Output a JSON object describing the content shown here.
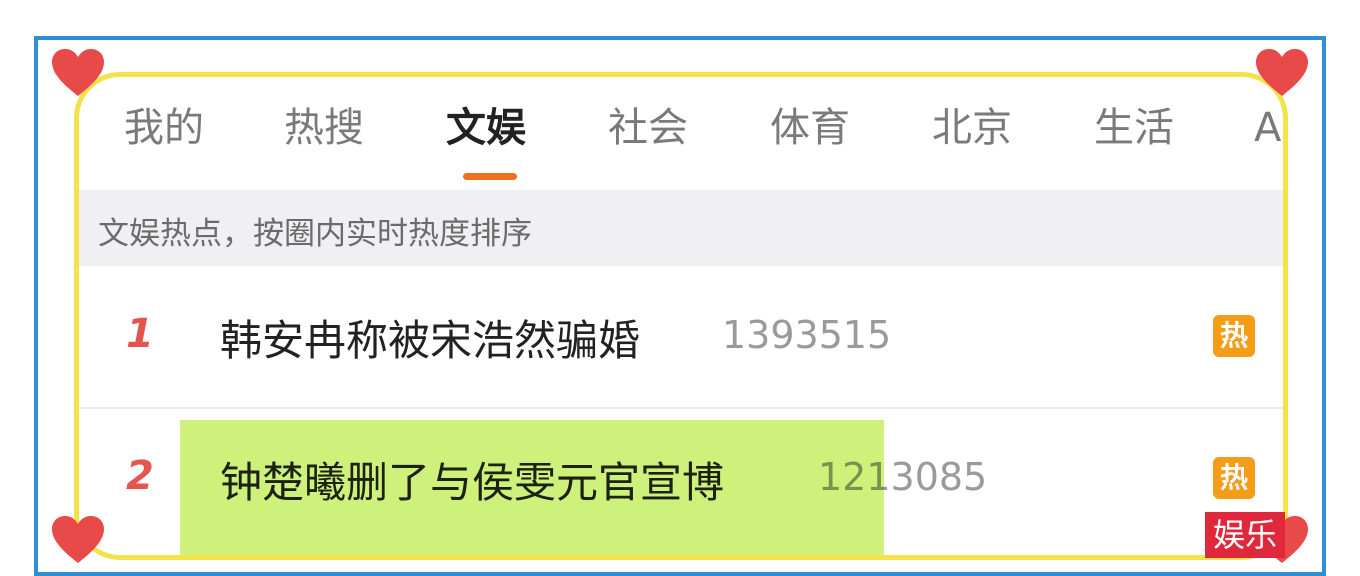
{
  "tabs": [
    {
      "label": "我的"
    },
    {
      "label": "热搜"
    },
    {
      "label": "文娱"
    },
    {
      "label": "社会"
    },
    {
      "label": "体育"
    },
    {
      "label": "北京"
    },
    {
      "label": "生活"
    },
    {
      "label": "A"
    }
  ],
  "active_tab": "文娱",
  "subheader": "文娱热点，按圈内实时热度排序",
  "list": [
    {
      "rank": "1",
      "title": "韩安冉称被宋浩然骗婚",
      "count": "1393515",
      "badge": "热"
    },
    {
      "rank": "2",
      "title": "钟楚曦删了与侯雯元官宣博",
      "count": "1213085",
      "badge": "热"
    }
  ],
  "watermark": "娱乐",
  "colors": {
    "accent": "#f0701d",
    "frame_blue": "#2f8fd6",
    "frame_yellow": "#f3e24a",
    "heart": "#e84a4a",
    "badge": "#f59c18",
    "rank": "#e5554f",
    "highlight": "#c7ef6a"
  },
  "icons": [
    "heart-icon",
    "heart-icon",
    "heart-icon",
    "heart-icon"
  ]
}
